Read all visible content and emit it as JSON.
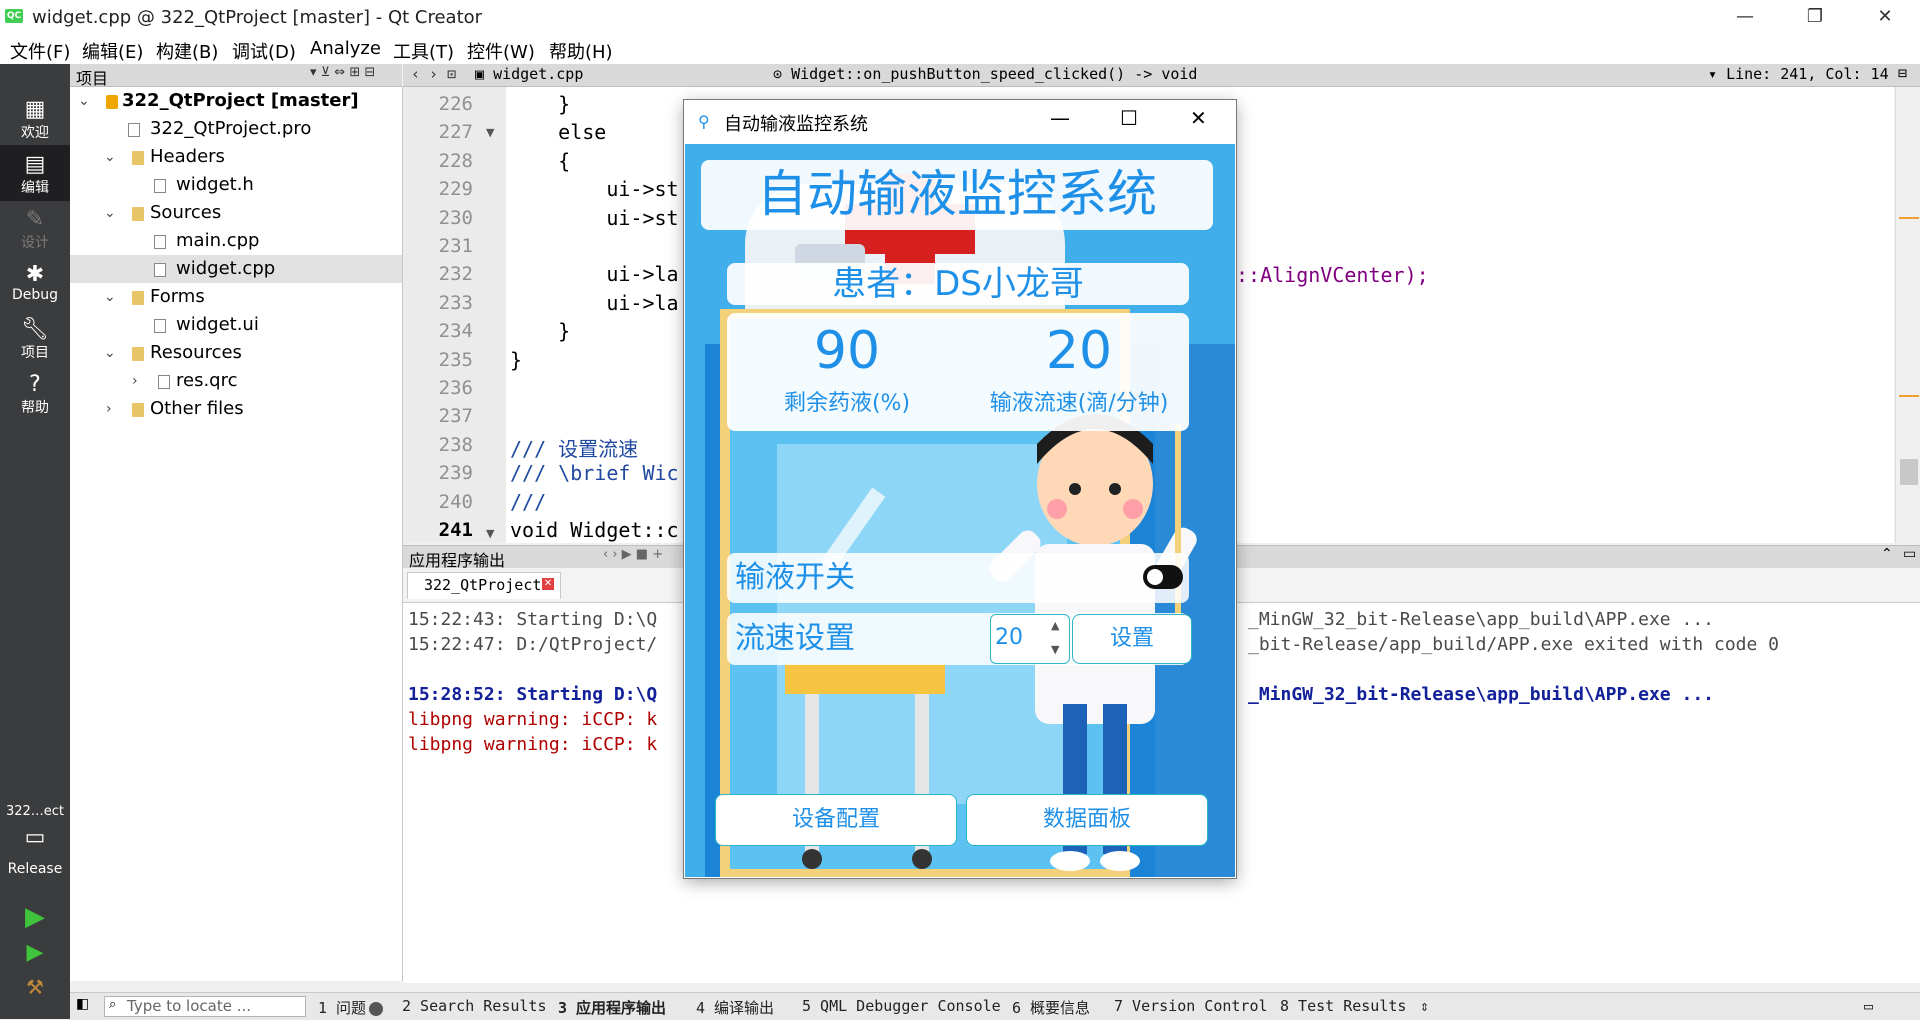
{
  "window": {
    "title": "widget.cpp @ 322_QtProject [master] - Qt Creator",
    "logo": "QC",
    "controls": [
      "—",
      "❐",
      "✕"
    ]
  },
  "menu": [
    "文件(F)",
    "编辑(E)",
    "构建(B)",
    "调试(D)",
    "Analyze",
    "工具(T)",
    "控件(W)",
    "帮助(H)"
  ],
  "modes": [
    {
      "label": "欢迎",
      "icon": "grid-icon"
    },
    {
      "label": "编辑",
      "icon": "edit-icon"
    },
    {
      "label": "设计",
      "icon": "design-icon"
    },
    {
      "label": "Debug",
      "icon": "bug-icon"
    },
    {
      "label": "项目",
      "icon": "wrench-icon"
    },
    {
      "label": "帮助",
      "icon": "help-icon"
    }
  ],
  "kit": {
    "project": "322…ect",
    "config": "Release"
  },
  "tree": {
    "header": "项目",
    "items": [
      {
        "label": "322_QtProject [master]",
        "level": 0,
        "type": "proj"
      },
      {
        "label": "322_QtProject.pro",
        "level": 1,
        "type": "file"
      },
      {
        "label": "Headers",
        "level": 1,
        "type": "folder"
      },
      {
        "label": "widget.h",
        "level": 2,
        "type": "file"
      },
      {
        "label": "Sources",
        "level": 1,
        "type": "folder"
      },
      {
        "label": "main.cpp",
        "level": 2,
        "type": "file"
      },
      {
        "label": "widget.cpp",
        "level": 2,
        "type": "file"
      },
      {
        "label": "Forms",
        "level": 1,
        "type": "folder"
      },
      {
        "label": "widget.ui",
        "level": 2,
        "type": "file"
      },
      {
        "label": "Resources",
        "level": 1,
        "type": "folder"
      },
      {
        "label": "res.qrc",
        "level": 2,
        "type": "file"
      },
      {
        "label": "Other files",
        "level": 1,
        "type": "folder"
      }
    ]
  },
  "editor": {
    "file": "widget.cpp",
    "symbol": "Widget::on_pushButton_speed_clicked() -> void",
    "position": "Line: 241, Col: 14",
    "lines": [
      {
        "n": "226",
        "code": "    }"
      },
      {
        "n": "227",
        "code": "    else"
      },
      {
        "n": "228",
        "code": "    {"
      },
      {
        "n": "229",
        "code": "        ui->st"
      },
      {
        "n": "230",
        "code": "        ui->st"
      },
      {
        "n": "231",
        "code": ""
      },
      {
        "n": "232",
        "code": "        ui->la"
      },
      {
        "n": "233",
        "code": "        ui->la"
      },
      {
        "n": "234",
        "code": "    }"
      },
      {
        "n": "235",
        "code": "}"
      },
      {
        "n": "236",
        "code": ""
      },
      {
        "n": "237",
        "code": ""
      },
      {
        "n": "238",
        "code": "/// 设置流速"
      },
      {
        "n": "239",
        "code": "/// \\brief Wic"
      },
      {
        "n": "240",
        "code": "///"
      },
      {
        "n": "241",
        "code": "void Widget::c"
      }
    ],
    "line232_tail": "::AlignVCenter);"
  },
  "output": {
    "header": "应用程序输出",
    "tab": "322_QtProject",
    "lines": [
      {
        "text": "15:22:43: Starting D:\\Q",
        "style": "normal"
      },
      {
        "text": "15:22:47: D:/QtProject/",
        "style": "normal"
      },
      {
        "text": "",
        "style": "normal"
      },
      {
        "text": "15:28:52: Starting D:\\Q",
        "style": "blue"
      },
      {
        "text": "libpng warning: iCCP: k",
        "style": "red"
      },
      {
        "text": "libpng warning: iCCP: k",
        "style": "red"
      }
    ],
    "tails": [
      {
        "text": "_MinGW_32_bit-Release\\app_build\\APP.exe ...",
        "style": "normal"
      },
      {
        "text": "_bit-Release/app_build/APP.exe exited with code 0",
        "style": "normal"
      },
      {
        "text": "",
        "style": "normal"
      },
      {
        "text": "_MinGW_32_bit-Release\\app_build\\APP.exe ...",
        "style": "blue"
      }
    ]
  },
  "statusbar": {
    "search_placeholder": "Type to locate ...",
    "tabs": [
      "1 问题",
      "2 Search Results",
      "3 应用程序输出",
      "4 编译输出",
      "5 QML Debugger Console",
      "6 概要信息",
      "7 Version Control",
      "8 Test Results"
    ]
  },
  "dialog": {
    "title": "自动输液监控系统",
    "heading": "自动输液监控系统",
    "patient": "患者：DS小龙哥",
    "remaining_value": "90",
    "remaining_label": "剩余药液(%)",
    "speed_value": "20",
    "speed_label": "输液流速(滴/分钟)",
    "switch_label": "输液开关",
    "switch_on": true,
    "speed_setting_label": "流速设置",
    "speed_input": "20",
    "set_button": "设置",
    "device_config_button": "设备配置",
    "data_panel_button": "数据面板"
  }
}
